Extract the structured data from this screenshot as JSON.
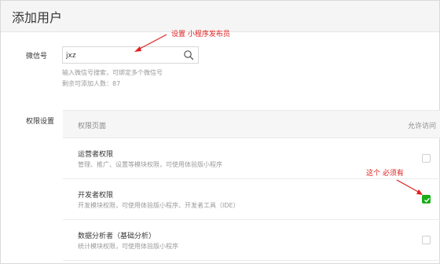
{
  "header": {
    "title": "添加用户"
  },
  "wechat": {
    "label": "微信号",
    "value": "jxz",
    "hint1": "输入微信号搜索，可绑定多个微信号",
    "hint2": "剩余可添加人数：87"
  },
  "annotations": {
    "top": "设置 小程序发布员",
    "right": "这个 必须有"
  },
  "permissions": {
    "label": "权限设置",
    "col_page": "权限页面",
    "col_allow": "允许访问",
    "rows": [
      {
        "title": "运营者权限",
        "desc": "管理、推广、设置等模块权限，可使用体验版小程序",
        "checked": false
      },
      {
        "title": "开发者权限",
        "desc": "开发模块权限，可使用体验版小程序、开发者工具（IDE）",
        "checked": true
      },
      {
        "title": "数据分析者（基础分析）",
        "desc": "统计模块权限，可使用体验版小程序",
        "checked": false
      }
    ]
  },
  "colors": {
    "accent": "#1aad19",
    "annotation": "#e02020"
  }
}
